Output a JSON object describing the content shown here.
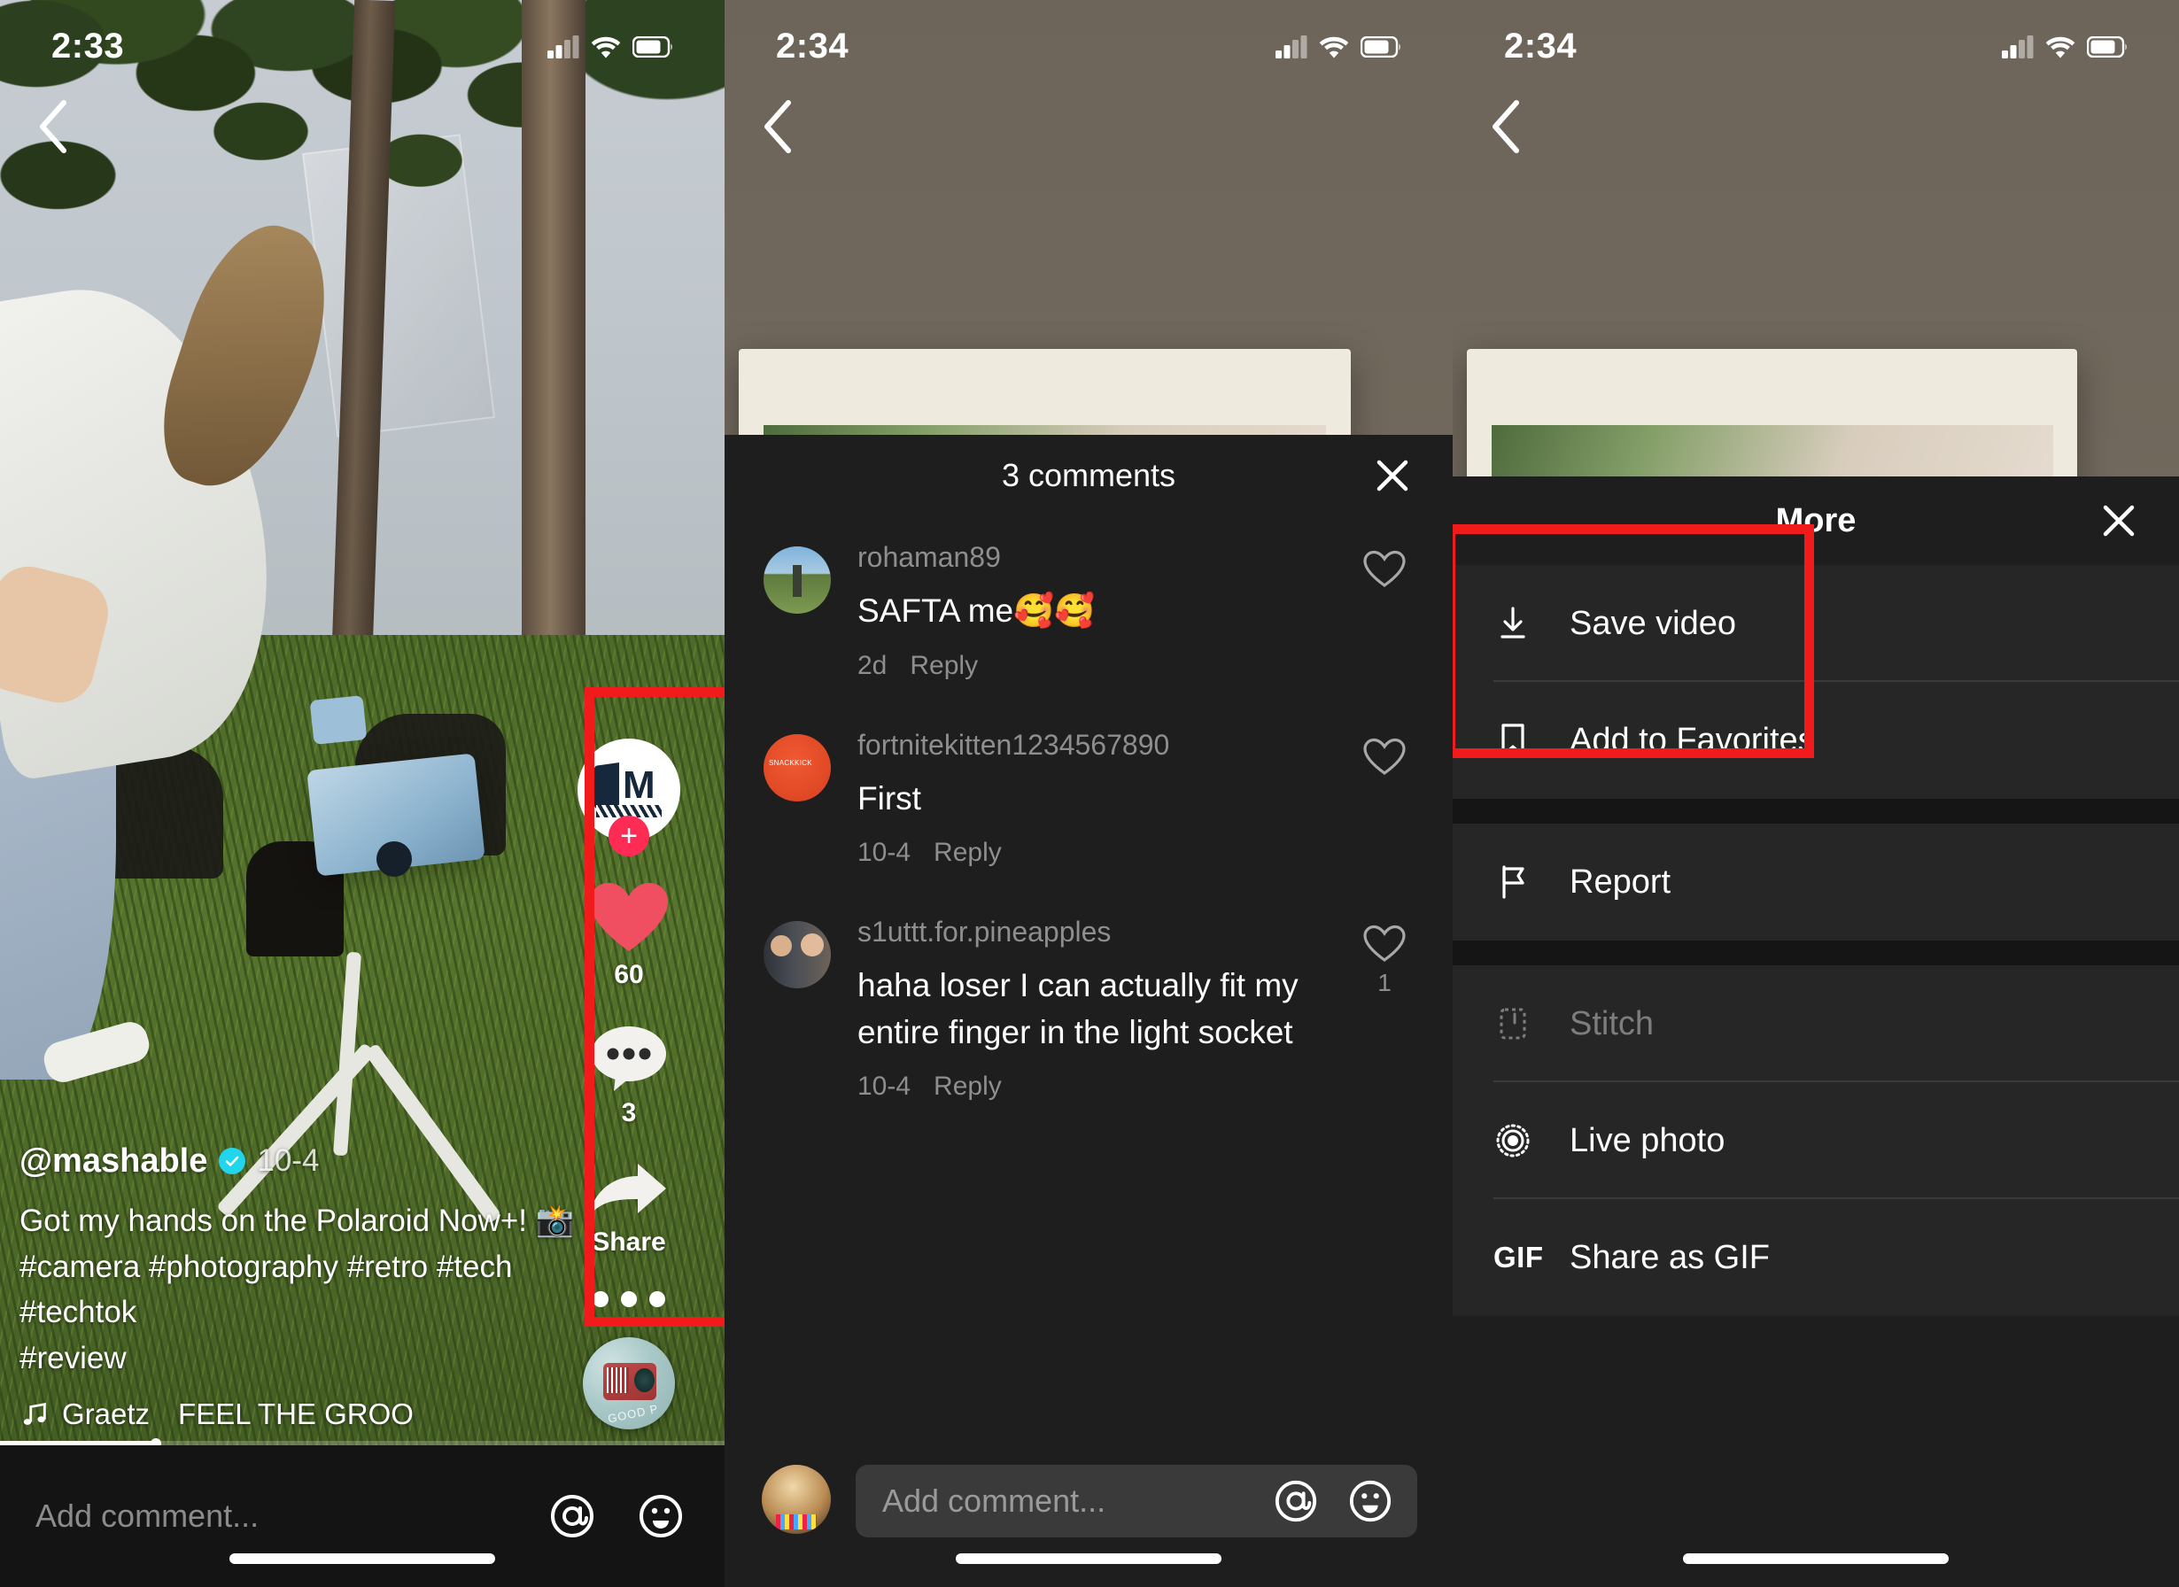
{
  "panels": {
    "feed": {
      "status": {
        "time": "2:33",
        "cellular_icon": "cellular-signal-icon",
        "wifi_icon": "wifi-icon",
        "battery_icon": "battery-icon"
      },
      "back_icon": "back-chevron-icon",
      "author": {
        "username": "@mashable",
        "verified_icon": "verified-badge-icon",
        "date": "10-4"
      },
      "caption_line1": "Got my hands on the Polaroid Now+! 📸",
      "caption_line2": "#camera #photography #retro #tech #techtok",
      "caption_line3": "#review",
      "music": {
        "note_icon": "music-note-icon",
        "artist": "Graetz",
        "title": "FEEL THE GROO"
      },
      "rail": {
        "avatar_name": "mashable-avatar",
        "follow_label": "+",
        "like_icon": "heart-icon",
        "like_count": "60",
        "comment_icon": "comment-bubble-icon",
        "comment_count": "3",
        "share_icon": "share-arrow-icon",
        "share_label": "Share",
        "more_icon": "more-dots-icon",
        "disc_icon": "music-disc-icon"
      },
      "comment_bar": {
        "placeholder": "Add comment...",
        "mention_icon": "at-mention-icon",
        "emoji_icon": "emoji-smiley-icon"
      }
    },
    "comments": {
      "status": {
        "time": "2:34",
        "cellular_icon": "cellular-signal-icon",
        "wifi_icon": "wifi-icon",
        "battery_icon": "battery-icon"
      },
      "back_icon": "back-chevron-icon",
      "sheet_title": "3 comments",
      "close_icon": "close-x-icon",
      "list": [
        {
          "avatar": "rohaman89-avatar",
          "username": "rohaman89",
          "text": "SAFTA me🥰🥰",
          "time": "2d",
          "reply_label": "Reply",
          "like_icon": "heart-outline-icon",
          "like_count": ""
        },
        {
          "avatar": "fortnitekitten-avatar",
          "username": "fortnitekitten1234567890",
          "text": "First",
          "time": "10-4",
          "reply_label": "Reply",
          "like_icon": "heart-outline-icon",
          "like_count": ""
        },
        {
          "avatar": "s1uttt-avatar",
          "username": "s1uttt.for.pineapples",
          "text": "haha loser I can actually fit my entire finger in the light socket",
          "time": "10-4",
          "reply_label": "Reply",
          "like_icon": "heart-outline-icon",
          "like_count": "1"
        }
      ],
      "comment_bar": {
        "avatar": "current-user-avatar",
        "placeholder": "Add comment...",
        "mention_icon": "at-mention-icon",
        "emoji_icon": "emoji-smiley-icon"
      }
    },
    "more": {
      "status": {
        "time": "2:34",
        "cellular_icon": "cellular-signal-icon",
        "wifi_icon": "wifi-icon",
        "battery_icon": "battery-icon"
      },
      "back_icon": "back-chevron-icon",
      "sheet_title": "More",
      "close_icon": "close-x-icon",
      "items": [
        {
          "label": "Save video",
          "icon": "download-icon",
          "disabled": false
        },
        {
          "label": "Add to Favorites",
          "icon": "bookmark-icon",
          "disabled": false
        },
        {
          "label": "Report",
          "icon": "flag-icon",
          "disabled": false
        },
        {
          "label": "Stitch",
          "icon": "stitch-icon",
          "disabled": true
        },
        {
          "label": "Live photo",
          "icon": "live-photo-icon",
          "disabled": false
        },
        {
          "label": "Share as GIF",
          "icon": "gif-icon",
          "disabled": false
        }
      ]
    }
  },
  "annotations": {
    "highlight_color": "#f21b1b",
    "box1_target": "video-side-rail",
    "box2_target": "save-video-and-add-to-favorites"
  }
}
